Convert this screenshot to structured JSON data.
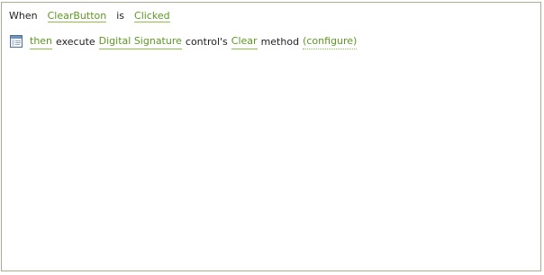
{
  "trigger": {
    "when": "When",
    "control": "ClearButton",
    "is": "is",
    "event": "Clicked"
  },
  "action": {
    "icon": "window-icon",
    "then": "then",
    "execute": "execute",
    "target_control": "Digital Signature",
    "controls": "control's",
    "method_name": "Clear",
    "method": "method",
    "configure": "(configure)"
  },
  "colors": {
    "link": "#5a9a1c",
    "border": "#a6ad93",
    "text": "#1f1f1f"
  }
}
